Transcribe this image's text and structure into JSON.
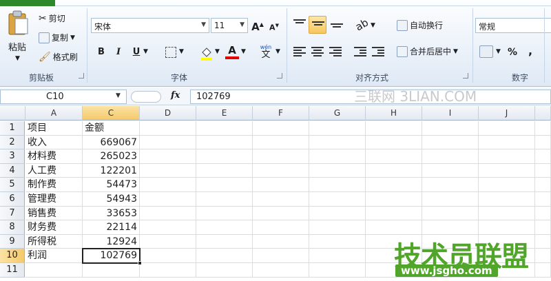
{
  "ribbon": {
    "clipboard": {
      "paste": "粘贴",
      "cut": "剪切",
      "copy": "复制",
      "format_painter": "格式刷",
      "label": "剪贴板"
    },
    "font": {
      "name": "宋体",
      "size": "11",
      "grow": "A",
      "shrink": "A",
      "bold": "B",
      "italic": "I",
      "underline": "U",
      "font_color": "A",
      "wen": "wén",
      "wen_char": "文",
      "label": "字体"
    },
    "alignment": {
      "wrap_text": "自动换行",
      "merge_center": "合并后居中",
      "label": "对齐方式"
    },
    "number": {
      "format": "常规",
      "percent": "%",
      "comma": ",",
      "label": "数字"
    }
  },
  "formula_bar": {
    "name_box": "C10",
    "fx": "fx",
    "value": "102769"
  },
  "watermark_top": "三联网 3LIAN.COM",
  "watermark_logo": "技术员联盟",
  "watermark_url": "www.jsgho.com",
  "columns": [
    "A",
    "C",
    "D",
    "E",
    "F",
    "G",
    "H",
    "I",
    "J"
  ],
  "rows": [
    "1",
    "2",
    "3",
    "4",
    "5",
    "6",
    "7",
    "8",
    "9",
    "10",
    "11"
  ],
  "table": [
    {
      "a": "项目",
      "c": "金额"
    },
    {
      "a": "收入",
      "c": "669067"
    },
    {
      "a": "材料费",
      "c": "265023"
    },
    {
      "a": "人工费",
      "c": "122201"
    },
    {
      "a": "制作费",
      "c": "54473"
    },
    {
      "a": "管理费",
      "c": "54943"
    },
    {
      "a": "销售费",
      "c": "33653"
    },
    {
      "a": "财务费",
      "c": "22114"
    },
    {
      "a": "所得税",
      "c": "12924"
    },
    {
      "a": "利润",
      "c": "102769"
    }
  ],
  "colors": {
    "selection": "#f5c96b",
    "accent_green": "#2c8a2c"
  }
}
